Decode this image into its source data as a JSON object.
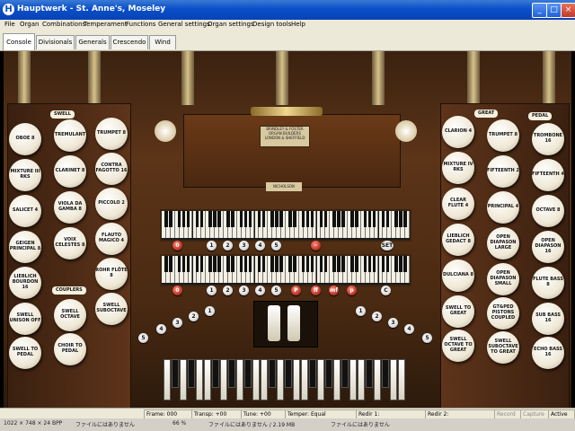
{
  "window": {
    "title": "Hauptwerk - St. Anne's, Moseley",
    "min_label": "_",
    "max_label": "□",
    "close_label": "×"
  },
  "menu": [
    "File",
    "Organ",
    "Combinations",
    "Temperament",
    "Functions",
    "General settings",
    "Organ settings",
    "Design tools",
    "Help"
  ],
  "tabs": [
    {
      "label": "Console",
      "active": true
    },
    {
      "label": "Divisionals",
      "active": false
    },
    {
      "label": "Generals",
      "active": false
    },
    {
      "label": "Crescendo",
      "active": false
    },
    {
      "label": "Wind",
      "active": false
    }
  ],
  "console": {
    "nameplate": "BRINDLEY & FOSTER\nORGAN BUILDERS\nLONDON & SHEFFIELD",
    "small_plate": "NICHOLSON",
    "swell_label": "SWELL",
    "couplers_label": "COUPLERS",
    "great_label": "GREAT",
    "pedal_label": "PEDAL",
    "swell_stops": [
      "OBOE 8",
      "MIXTURE III RKS",
      "SALICET 4",
      "GEIGEN PRINCIPAL 8",
      "LIEBLICH BOURDON 16"
    ],
    "swell_stops2": [
      "TREMULANT",
      "CLARINET 8",
      "VIOLA DA GAMBA 8",
      "VOIX CELESTES 8",
      "ROHR FLÖTE 8"
    ],
    "swell_stops3": [
      "TRUMPET 8",
      "CONTRA FAGOTTO 16",
      "PICCOLO 2",
      "FLAUTO MAGICO 4",
      "SWELL SUBOCTAVE"
    ],
    "coupler_stops": [
      "SWELL UNISON OFF",
      "SWELL TO PEDAL",
      "SWELL OCTAVE",
      "CHOIR TO PEDAL"
    ],
    "great_stops1": [
      "CLARION 4",
      "MIXTURE IV RKS",
      "CLEAR FLUTE 4",
      "LIEBLICH GEDACT 8",
      "DULCIANA 8",
      "SWELL TO GREAT",
      "SWELL OCTAVE TO GREAT"
    ],
    "great_stops2": [
      "TRUMPET 8",
      "FIFTEENTH 2",
      "PRINCIPAL 4",
      "OPEN DIAPASON LARGE",
      "OPEN DIAPASON SMALL",
      "GT&PED PISTONS COUPLED",
      "SWELL SUBOCTAVE TO GREAT"
    ],
    "pedal_stops": [
      "TROMBONE 16",
      "FIFTEENTH 4",
      "OCTAVE 8",
      "OPEN DIAPASON 16",
      "FLUTE BASS 8",
      "SUB BASS 16",
      "ECHO BASS 16"
    ],
    "upper_pistons": [
      "0",
      "1",
      "2",
      "3",
      "4",
      "5",
      "-",
      "SET"
    ],
    "lower_pistons": [
      "0",
      "1",
      "2",
      "3",
      "4",
      "5",
      "P",
      "ff",
      "mf",
      "p",
      "C"
    ],
    "toe_pistons_left": [
      "5",
      "4",
      "3",
      "2",
      "1"
    ],
    "toe_pistons_right": [
      "1",
      "2",
      "3",
      "4",
      "5"
    ]
  },
  "status": {
    "frame": "Frame: 000",
    "transp": "Transp: +00",
    "tune": "Tune: +00",
    "temper": "Temper: Equal",
    "redir1": "Redir 1:",
    "redir2": "Redir 2:",
    "record": "Record",
    "capture": "Capture",
    "active": "Active"
  },
  "info": {
    "resolution": "1022 × 748 × 24 BPP",
    "msg1": "ファイルにはありません",
    "zoom": "66 %",
    "msg2": "ファイルにはありません / 2.19 MB",
    "msg3": "ファイルにはありません"
  }
}
